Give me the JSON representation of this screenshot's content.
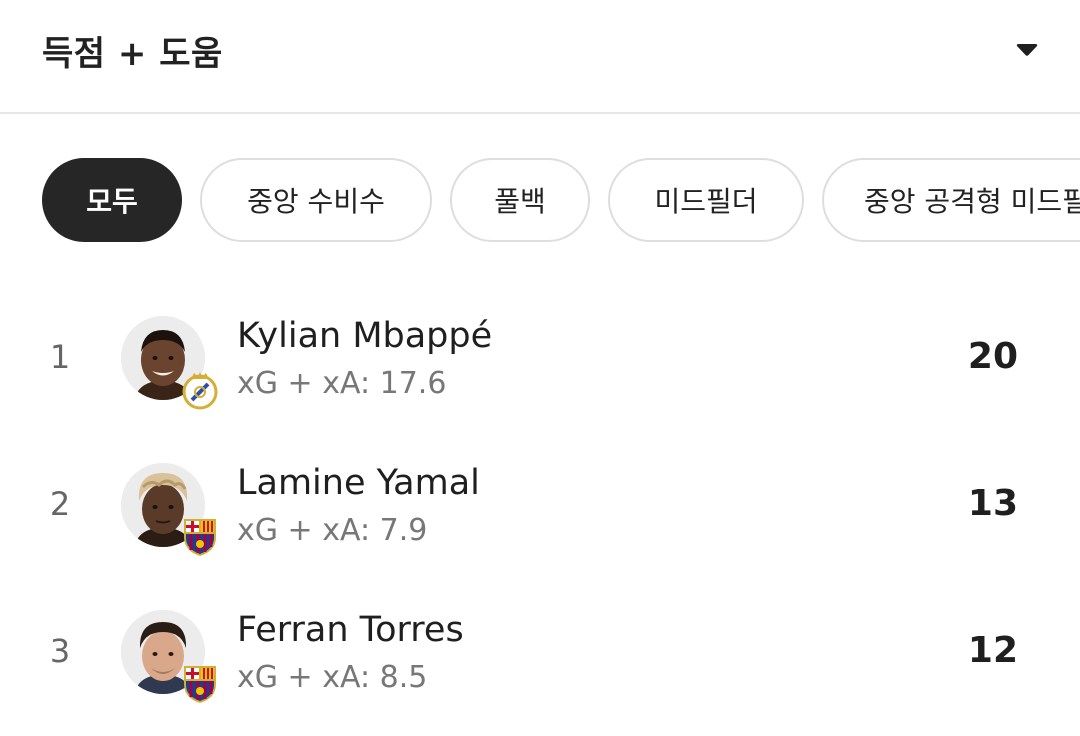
{
  "header": {
    "title": "득점 + 도움",
    "dropdown_icon": "caret-down-icon"
  },
  "filters": [
    {
      "label": "모두",
      "active": true
    },
    {
      "label": "중앙 수비수",
      "active": false
    },
    {
      "label": "풀백",
      "active": false
    },
    {
      "label": "미드필더",
      "active": false
    },
    {
      "label": "중앙 공격형 미드필더",
      "active": false
    }
  ],
  "players": [
    {
      "rank": "1",
      "name": "Kylian Mbappé",
      "sub": "xG + xA: 17.6",
      "value": "20",
      "club_badge": "real-madrid-badge-icon"
    },
    {
      "rank": "2",
      "name": "Lamine Yamal",
      "sub": "xG + xA: 7.9",
      "value": "13",
      "club_badge": "barcelona-badge-icon"
    },
    {
      "rank": "3",
      "name": "Ferran Torres",
      "sub": "xG + xA: 8.5",
      "value": "12",
      "club_badge": "barcelona-badge-icon"
    }
  ],
  "colors": {
    "active_chip": "#262626",
    "chip_border": "#dedede",
    "divider": "#e6e6e6",
    "barca_blue": "#1d3e8a",
    "barca_red": "#a50044",
    "real_gold": "#d4af37"
  }
}
